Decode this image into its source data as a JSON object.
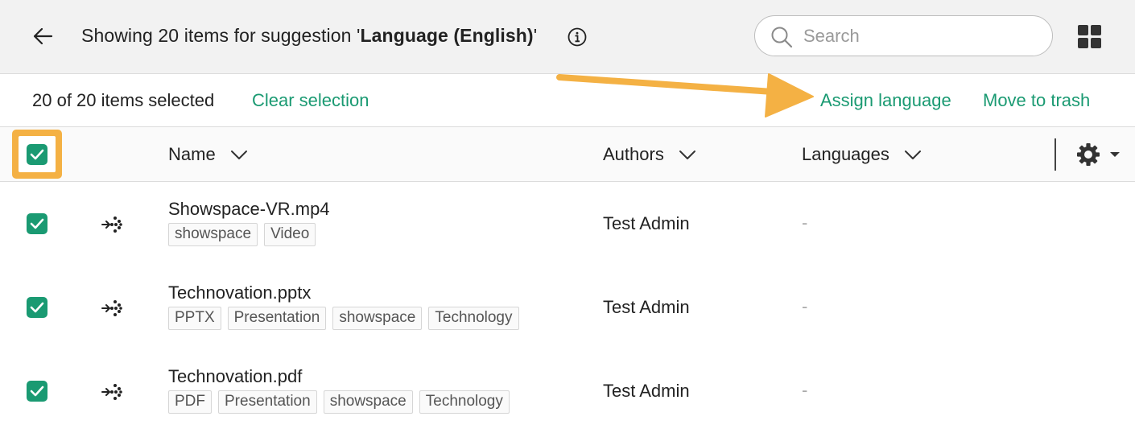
{
  "header": {
    "title_prefix": "Showing 20 items for suggestion '",
    "title_bold": "Language (English)",
    "title_suffix": "'"
  },
  "search": {
    "placeholder": "Search",
    "value": ""
  },
  "selection": {
    "count_text": "20 of 20 items selected",
    "clear_label": "Clear selection",
    "assign_label": "Assign language",
    "trash_label": "Move to trash"
  },
  "columns": {
    "name": "Name",
    "authors": "Authors",
    "languages": "Languages"
  },
  "rows": [
    {
      "name": "Showspace-VR.mp4",
      "tags": [
        "showspace",
        "Video"
      ],
      "author": "Test Admin",
      "language": "-",
      "checked": true
    },
    {
      "name": "Technovation.pptx",
      "tags": [
        "PPTX",
        "Presentation",
        "showspace",
        "Technology"
      ],
      "author": "Test Admin",
      "language": "-",
      "checked": true
    },
    {
      "name": "Technovation.pdf",
      "tags": [
        "PDF",
        "Presentation",
        "showspace",
        "Technology"
      ],
      "author": "Test Admin",
      "language": "-",
      "checked": true
    }
  ],
  "icons": {
    "back": "arrow-left-icon",
    "info": "info-icon",
    "search": "search-icon",
    "grid": "grid-icon",
    "settings": "gear-icon",
    "row_type": "hub-icon"
  },
  "colors": {
    "accent": "#1a9a72",
    "highlight": "#f4b144",
    "header_bg": "#f2f2f2"
  }
}
